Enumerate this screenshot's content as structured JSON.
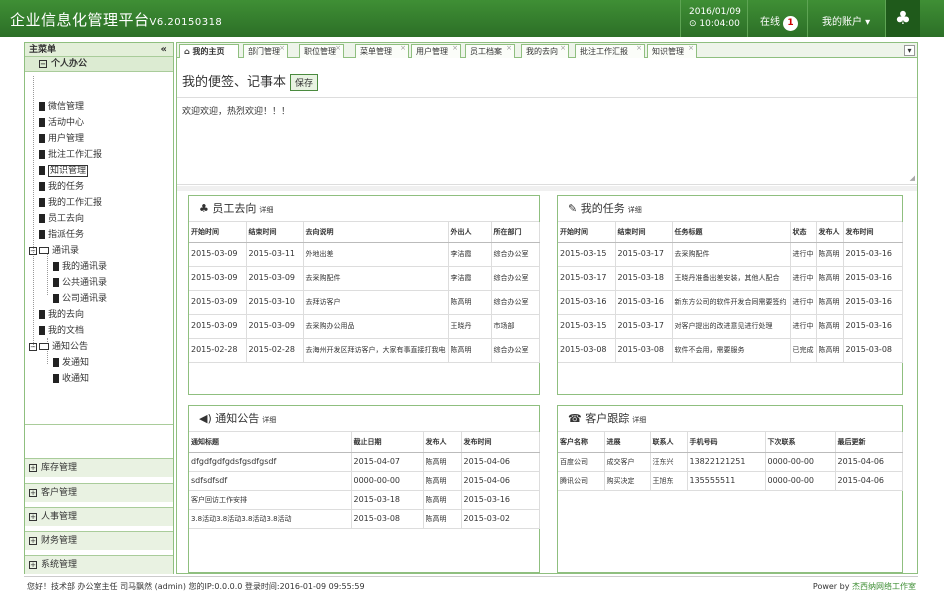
{
  "header": {
    "title": "企业信息化管理平台",
    "version": "V6.20150318",
    "date": "2016/01/09",
    "time": "⊙ 10:04:00",
    "online_label": "在线",
    "online_count": "1",
    "account_label": "我的账户 ▾"
  },
  "sidebar": {
    "title": "主菜单",
    "collapse": "«",
    "group": "个人办公",
    "items": [
      "微信管理",
      "活动中心",
      "用户管理",
      "批注工作汇报",
      "知识管理",
      "我的任务",
      "我的工作汇报",
      "员工去向",
      "指派任务",
      "通讯录",
      "我的通讯录",
      "公共通讯录",
      "公司通讯录",
      "我的去向",
      "我的文档",
      "通知公告",
      "发通知",
      "收通知"
    ],
    "bottom": [
      "库存管理",
      "客户管理",
      "人事管理",
      "财务管理",
      "系统管理"
    ]
  },
  "tabs": [
    "我的主页",
    "部门管理",
    "职位管理",
    "菜单管理",
    "用户管理",
    "员工档案",
    "我的去向",
    "批注工作汇报",
    "知识管理"
  ],
  "note": {
    "title": "我的便签、记事本",
    "save": "保存",
    "content": "欢迎欢迎，热烈欢迎！！！"
  },
  "staff": {
    "title": "员工去向",
    "more": "详细",
    "cols": [
      "开始时间",
      "结束时间",
      "去向说明",
      "外出人",
      "所在部门"
    ],
    "rows": [
      [
        "2015-03-09",
        "2015-03-11",
        "外地出差",
        "李洁霞",
        "综合办公室"
      ],
      [
        "2015-03-09",
        "2015-03-09",
        "去采购配件",
        "李洁霞",
        "综合办公室"
      ],
      [
        "2015-03-09",
        "2015-03-10",
        "去拜访客户",
        "陈高明",
        "综合办公室"
      ],
      [
        "2015-03-09",
        "2015-03-09",
        "去采购办公用品",
        "王晓丹",
        "市场部"
      ],
      [
        "2015-02-28",
        "2015-02-28",
        "去海州开发区拜访客户，大家有事直接打我电",
        "陈高明",
        "综合办公室"
      ]
    ]
  },
  "tasks": {
    "title": "我的任务",
    "more": "详细",
    "cols": [
      "开始时间",
      "结束时间",
      "任务标题",
      "状态",
      "发布人",
      "发布时间"
    ],
    "rows": [
      [
        "2015-03-15",
        "2015-03-17",
        "去采购配件",
        "进行中",
        "陈高明",
        "2015-03-16"
      ],
      [
        "2015-03-17",
        "2015-03-18",
        "王晓丹准备出差安装，其他人配合",
        "进行中",
        "陈高明",
        "2015-03-16"
      ],
      [
        "2015-03-16",
        "2015-03-16",
        "新东方公司的软件开发合同需要签约",
        "进行中",
        "陈高明",
        "2015-03-16"
      ],
      [
        "2015-03-15",
        "2015-03-17",
        "对客户提出的改进意见进行处理",
        "进行中",
        "陈高明",
        "2015-03-16"
      ],
      [
        "2015-03-08",
        "2015-03-08",
        "软件不会用，需要服务",
        "已完成",
        "陈高明",
        "2015-03-08"
      ]
    ]
  },
  "notice": {
    "title": "通知公告",
    "more": "详细",
    "cols": [
      "通知标题",
      "截止日期",
      "发布人",
      "发布时间"
    ],
    "rows": [
      [
        "dfgdfgdfgdsfgsdfgsdf",
        "2015-04-07",
        "陈高明",
        "2015-04-06"
      ],
      [
        "sdfsdfsdf",
        "0000-00-00",
        "陈高明",
        "2015-04-06"
      ],
      [
        "客户回访工作安排",
        "2015-03-18",
        "陈高明",
        "2015-03-16"
      ],
      [
        "3.8活动3.8活动3.8活动3.8活动",
        "2015-03-08",
        "陈高明",
        "2015-03-02"
      ]
    ]
  },
  "customer": {
    "title": "客户跟踪",
    "more": "详细",
    "cols": [
      "客户名称",
      "进展",
      "联系人",
      "手机号码",
      "下次联系",
      "最后更新"
    ],
    "rows": [
      [
        "百度公司",
        "成交客户",
        "汪东兴",
        "13822121251",
        "0000-00-00",
        "2015-04-06"
      ],
      [
        "腾讯公司",
        "购买决定",
        "王旭东",
        "135555511",
        "0000-00-00",
        "2015-04-06"
      ]
    ]
  },
  "footer": {
    "left": "您好！技术部 办公室主任 司马飘然 (admin) 您的IP:0.0.0.0 登录时间:2016-01-09 09:55:59",
    "power": "Power by ",
    "link": "杰西纳网络工作室"
  }
}
